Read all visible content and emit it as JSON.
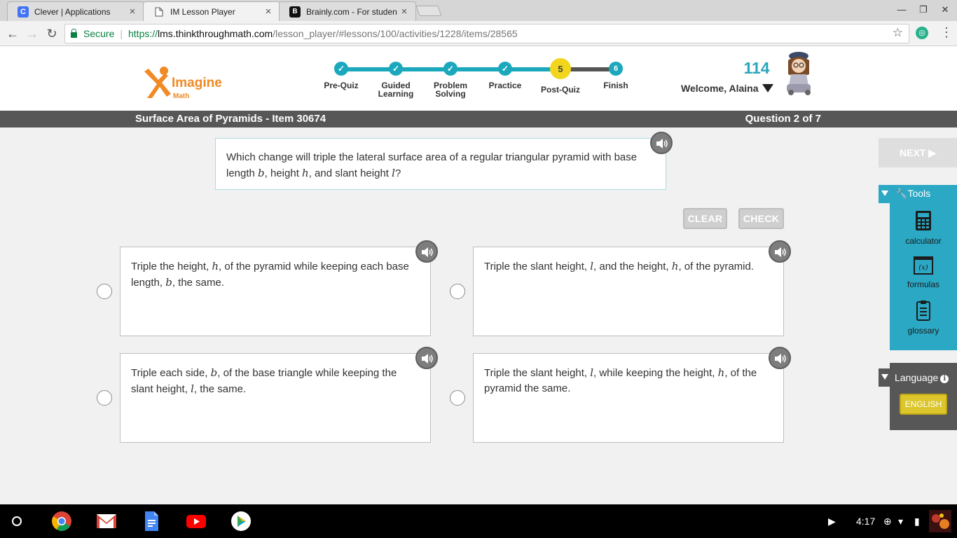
{
  "browser": {
    "tabs": [
      {
        "title": "Clever | Applications",
        "icon": "clever-icon",
        "color": "#4274f6"
      },
      {
        "title": "IM Lesson Player",
        "icon": "page-icon",
        "color": "#ffffff"
      },
      {
        "title": "Brainly.com - For studen",
        "icon": "brainly-icon",
        "color": "#111111"
      }
    ],
    "close_glyph": "×",
    "secure_label": "Secure",
    "url_scheme": "https://",
    "url_host": "lms.thinkthroughmath.com",
    "url_path": "/lesson_player/#lessons/100/activities/1228/items/28565"
  },
  "header": {
    "logo_word": "Imagine",
    "logo_sub": "Math",
    "steps": [
      {
        "label": "Pre-Quiz",
        "status": "done"
      },
      {
        "label": "Guided Learning",
        "status": "done"
      },
      {
        "label": "Problem Solving",
        "status": "done"
      },
      {
        "label": "Practice",
        "status": "done"
      },
      {
        "label": "Post-Quiz",
        "status": "current",
        "number": "5"
      },
      {
        "label": "Finish",
        "status": "todo",
        "number": "6"
      }
    ],
    "points": "114",
    "welcome": "Welcome, Alaina"
  },
  "lesson": {
    "title": "Surface Area of Pyramids - Item 30674",
    "question_count": "Question 2 of 7"
  },
  "question": {
    "t1": "Which change will triple the lateral surface area of a regular triangular pyramid with base length ",
    "v1": "b",
    "t2": ", height ",
    "v2": "h",
    "t3": ", and slant height ",
    "v3": "l",
    "t4": "?"
  },
  "buttons": {
    "clear": "CLEAR",
    "check": "CHECK",
    "next": "NEXT ▶"
  },
  "answers": [
    {
      "t1": "Triple the height, ",
      "v1": "h",
      "t2": ", of the pyramid while keeping each base length, ",
      "v2": "b",
      "t3": ", the same."
    },
    {
      "t1": "Triple the slant height, ",
      "v1": "l",
      "t2": ", and the height, ",
      "v2": "h",
      "t3": ", of the pyramid."
    },
    {
      "t1": "Triple each side, ",
      "v1": "b",
      "t2": ", of the base triangle while keeping the slant height, ",
      "v2": "l",
      "t3": ", the same."
    },
    {
      "t1": "Triple the slant height, ",
      "v1": "l",
      "t2": ", while keeping the height, ",
      "v2": "h",
      "t3": ", of the pyramid the same."
    }
  ],
  "tools": {
    "label": "Tools",
    "items": [
      {
        "label": "calculator",
        "icon": "calculator-icon"
      },
      {
        "label": "formulas",
        "icon": "formulas-icon"
      },
      {
        "label": "glossary",
        "icon": "glossary-icon"
      }
    ]
  },
  "language": {
    "label": "Language",
    "value": "ENGLISH"
  },
  "shelf": {
    "time": "4:17"
  },
  "colors": {
    "teal": "#2aa8c4",
    "progress_done": "#1ba8bd",
    "current_step": "#f2d61e",
    "logo_orange": "#f08a24"
  }
}
